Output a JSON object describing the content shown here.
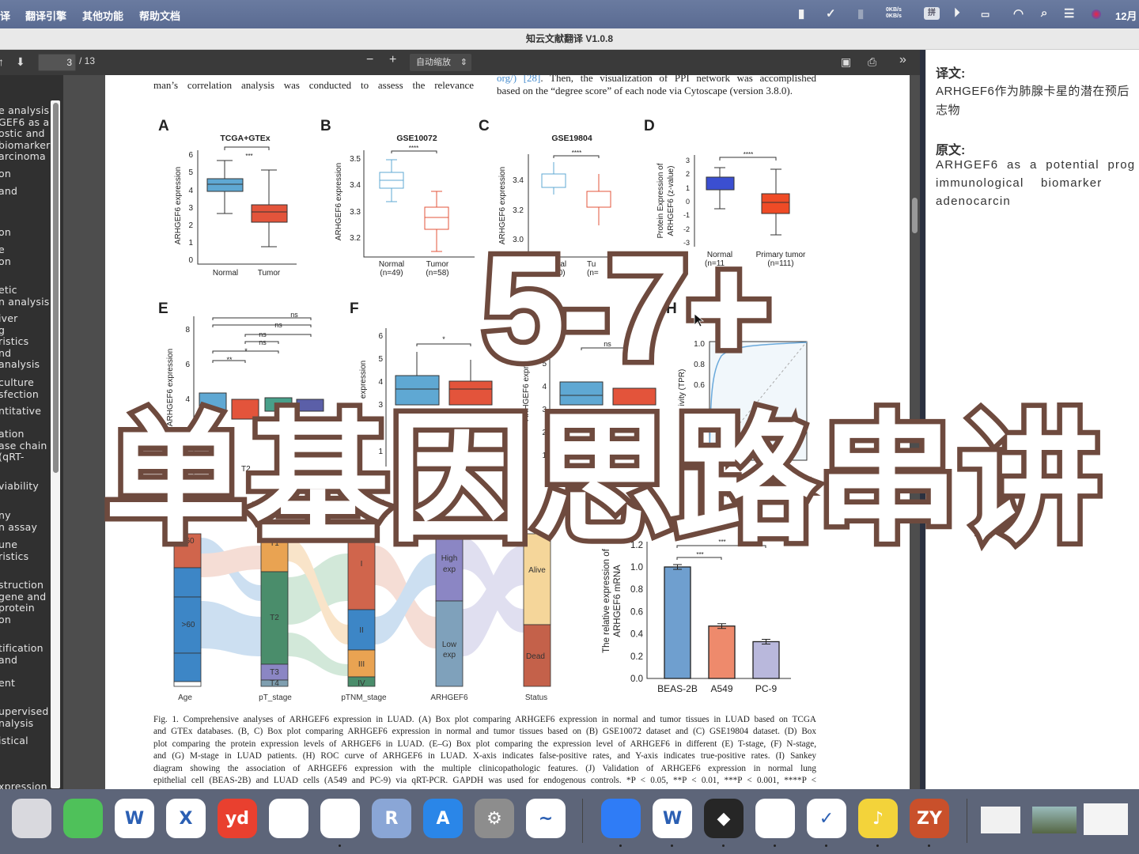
{
  "menubar": {
    "items": [
      "译",
      "翻译引擎",
      "其他功能",
      "帮助文档"
    ],
    "net_up": "0KB/s",
    "net_down": "0KB/s",
    "ime": "拼",
    "clock": "12月",
    "icons": [
      "bookmark-icon",
      "check-circle-icon",
      "bar-icon",
      "network-speed",
      "ime-icon",
      "play-icon",
      "battery-icon",
      "wifi-icon",
      "search-icon",
      "control-center-icon",
      "siri-icon"
    ]
  },
  "window": {
    "title": "知云文献翻译 V1.0.8"
  },
  "toolbar": {
    "page": "3",
    "total": "/ 13",
    "zoom": "自动缩放",
    "minus": "−",
    "plus": "+"
  },
  "sidebar": {
    "items": [
      "e analysis\nGEF6 as a\nostic and\nbiomarker\narcinoma",
      "on",
      "and",
      "on",
      "e\non",
      "etic\nn analysis",
      "iver\ng\nristics\nnd\nanalysis",
      "culture\nsfection",
      "ntitative",
      "ation\nase chain\n(qRT-",
      "viability",
      "ny\nn assay",
      "une\nristics",
      "struction\ngene and\nprotein\non",
      "tification\nand",
      "ent",
      "upervised\nnalysis",
      "istical",
      "xpression"
    ]
  },
  "paper": {
    "left_text": "man’s correlation analysis was conducted to assess the relevance",
    "right_text_1_link": "org/) [28]",
    "right_text_1": ". Then, the visualization of PPI network was accomplished",
    "right_text_2": "based on the “degree score” of each node via Cytoscape (version 3.8.0).",
    "figure": {
      "A": {
        "label": "A",
        "title": "TCGA+GTEx",
        "ylabel": "ARHGEF6 expression",
        "yticks": [
          "0",
          "1",
          "2",
          "3",
          "4",
          "5",
          "6"
        ],
        "groups": [
          "Normal",
          "Tumor"
        ],
        "sig": "***"
      },
      "B": {
        "label": "B",
        "title": "GSE10072",
        "ylabel": "ARHGEF6 expression",
        "yticks": [
          "3.2",
          "3.3",
          "3.4",
          "3.5"
        ],
        "groups": [
          "Normal",
          "Tumor"
        ],
        "n": [
          "(n=49)",
          "(n=58)"
        ],
        "sig": "****"
      },
      "C": {
        "label": "C",
        "title": "GSE19804",
        "ylabel": "ARHGEF6 expression",
        "yticks": [
          "3.0",
          "3.2",
          "3.4"
        ],
        "groups": [
          "Normal",
          "Tu"
        ],
        "n": [
          "(n=60)",
          "(n="
        ],
        "sig": "****"
      },
      "D": {
        "label": "D",
        "ylabel1": "Protein Expression of",
        "ylabel2": "ARHGEF6 (z-value)",
        "yticks": [
          "3",
          "2",
          "1",
          "0",
          "-1",
          "-2",
          "-3"
        ],
        "groups": [
          "Normal",
          "Primary tumor"
        ],
        "n": [
          "(n=11",
          "(n=111)"
        ],
        "sig": "****"
      },
      "E": {
        "label": "E",
        "ylabel": "ARHGEF6 expression",
        "yticks": [
          "8",
          "6",
          "4"
        ],
        "sig": [
          "ns",
          "ns",
          "ns",
          "ns",
          "*",
          "**"
        ],
        "xlabel_partial": "T2"
      },
      "F": {
        "label": "F",
        "ylabel": "expression",
        "yticks": [
          "6",
          "5",
          "4",
          "3",
          "1"
        ],
        "sig": "*"
      },
      "G": {
        "ylabel": "ARHGEF6 express",
        "yticks": [
          "6",
          "5",
          "4",
          "3",
          "2",
          "1"
        ],
        "sig": "ns"
      },
      "H": {
        "label": "H",
        "ylabel": "ivity (TPR)",
        "yticks": [
          "1.0",
          "0.8",
          "0.6"
        ]
      },
      "I": {
        "axes": [
          "Age",
          "pT_stage",
          "pTNM_stage",
          "ARHGEF6",
          "Status"
        ],
        "nodes": {
          "age": [
            "60",
            ">60"
          ],
          "pt": [
            "T1",
            "T2",
            "T3",
            "T4"
          ],
          "ptnm": [
            "I",
            "II",
            "III",
            "IV"
          ],
          "gene": [
            "High\nexp",
            "Low\nexp"
          ],
          "status": [
            "Alive",
            "Dead"
          ]
        }
      },
      "J": {
        "ylabel1": "The relative expression of",
        "ylabel2": "ARHGEF6 mRNA",
        "yticks": [
          "0.0",
          "0.2",
          "0.4",
          "0.6",
          "0.8",
          "1.0",
          "1.2"
        ],
        "categories": [
          "BEAS-2B",
          "A549",
          "PC-9"
        ],
        "values": [
          1.0,
          0.47,
          0.33
        ],
        "colors": [
          "#6f9fcf",
          "#ee8a6c",
          "#b9b8dc"
        ],
        "sig": [
          "***",
          "***"
        ]
      }
    },
    "caption": [
      "Fig. 1.  Comprehensive analyses of ARHGEF6 expression in LUAD. (A) Box plot comparing ARHGEF6 expression in normal and tumor tissues in LUAD based on TCGA",
      "and GTEx databases. (B, C) Box plot comparing ARHGEF6 expression in normal and tumor tissues based on (B) GSE10072 dataset and (C) GSE19804 dataset. (D) Box",
      "plot comparing the protein expression levels of ARHGEF6 in LUAD. (E–G) Box plot comparing the expression level of ARHGEF6 in different (E) T-stage, (F) N-stage,",
      "and (G) M-stage in LUAD patients. (H) ROC curve of ARHGEF6 in LUAD. X-axis indicates false-positive rates, and Y-axis indicates true-positive rates. (I) Sankey",
      "diagram showing the association of ARHGEF6 expression with the multiple clinicopathologic features. (J) Validation of ARHGEF6 expression in normal lung",
      "epithelial cell (BEAS-2B) and LUAD cells (A549 and PC-9) via qRT-PCR. GAPDH was used for endogenous controls. *P < 0.05, **P < 0.01, ***P < 0.001, ****P <"
    ]
  },
  "translation": {
    "label": "译文:",
    "text_1": "ARHGEF6作为肺腺卡星的潜在预后",
    "text_2": "志物",
    "orig_label": "原文:",
    "orig_1": "ARHGEF6  as  a  potential  prog",
    "orig_2": "immunological    biomarker",
    "orig_3": "adenocarcin"
  },
  "overlay": {
    "line1": "5-7+",
    "line2": "单基因思路串讲",
    "stroke": "#6e4a3e"
  },
  "dock": {
    "apps": [
      {
        "name": "launchpad",
        "label": "",
        "color": "#d9d9de"
      },
      {
        "name": "wechat",
        "label": "",
        "color": "#4fc15a"
      },
      {
        "name": "word",
        "label": "W",
        "color": "#ffffff"
      },
      {
        "name": "excel",
        "label": "X",
        "color": "#ffffff"
      },
      {
        "name": "youdao",
        "label": "yd",
        "color": "#e9402f"
      },
      {
        "name": "safari",
        "label": "",
        "color": "#ffffff"
      },
      {
        "name": "chrome",
        "label": "",
        "color": "#ffffff"
      },
      {
        "name": "r",
        "label": "R",
        "color": "#8aa6d6"
      },
      {
        "name": "app-store",
        "label": "A",
        "color": "#2a86e8"
      },
      {
        "name": "system-settings",
        "label": "⚙",
        "color": "#8d8d8d"
      },
      {
        "name": "freeform",
        "label": "~",
        "color": "#ffffff"
      },
      {
        "name": "lark",
        "label": "",
        "color": "#2f7cf6"
      },
      {
        "name": "wps",
        "label": "W",
        "color": "#ffffff"
      },
      {
        "name": "obsidian",
        "label": "◆",
        "color": "#262626"
      },
      {
        "name": "tencent-docs",
        "label": "",
        "color": "#ffffff"
      },
      {
        "name": "ticktick",
        "label": "✓",
        "color": "#ffffff"
      },
      {
        "name": "music",
        "label": "♪",
        "color": "#f3d33a"
      },
      {
        "name": "zotero",
        "label": "ZY",
        "color": "#c9502b"
      }
    ]
  }
}
